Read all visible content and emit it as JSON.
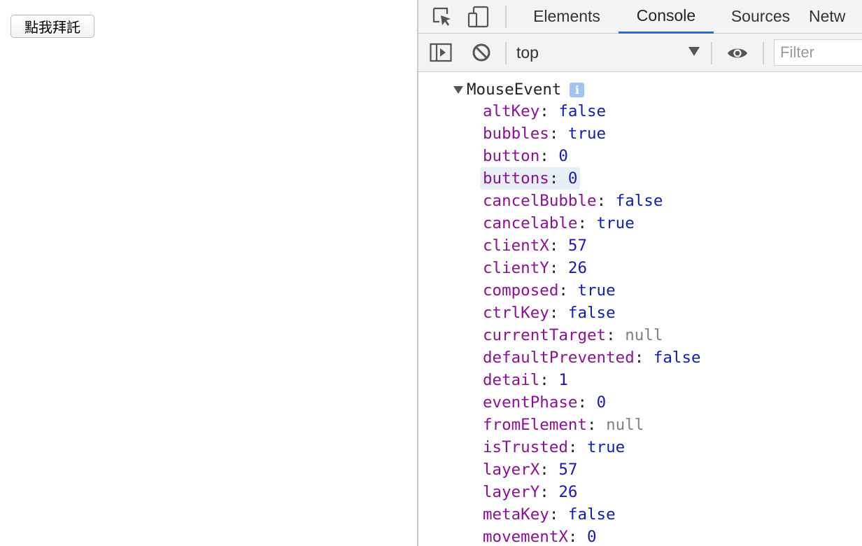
{
  "page": {
    "button_label": "點我拜託"
  },
  "devtools": {
    "tabs": [
      {
        "label": "Elements",
        "active": false
      },
      {
        "label": "Console",
        "active": true
      },
      {
        "label": "Sources",
        "active": false
      },
      {
        "label": "Netw",
        "active": false
      }
    ],
    "toolbar": {
      "context": "top",
      "filter_placeholder": "Filter"
    },
    "colors": {
      "accent": "#1a73e8",
      "key": "#881391",
      "bool": "#0d22aa",
      "null": "#808080"
    }
  },
  "console": {
    "object_name": "MouseEvent",
    "info_glyph": "i",
    "colon": ":",
    "properties": [
      {
        "key": "altKey",
        "value": "false",
        "type": "bool"
      },
      {
        "key": "bubbles",
        "value": "true",
        "type": "bool"
      },
      {
        "key": "button",
        "value": "0",
        "type": "num"
      },
      {
        "key": "buttons",
        "value": "0",
        "type": "num",
        "hover": true
      },
      {
        "key": "cancelBubble",
        "value": "false",
        "type": "bool"
      },
      {
        "key": "cancelable",
        "value": "true",
        "type": "bool"
      },
      {
        "key": "clientX",
        "value": "57",
        "type": "num"
      },
      {
        "key": "clientY",
        "value": "26",
        "type": "num"
      },
      {
        "key": "composed",
        "value": "true",
        "type": "bool"
      },
      {
        "key": "ctrlKey",
        "value": "false",
        "type": "bool"
      },
      {
        "key": "currentTarget",
        "value": "null",
        "type": "null"
      },
      {
        "key": "defaultPrevented",
        "value": "false",
        "type": "bool"
      },
      {
        "key": "detail",
        "value": "1",
        "type": "num"
      },
      {
        "key": "eventPhase",
        "value": "0",
        "type": "num"
      },
      {
        "key": "fromElement",
        "value": "null",
        "type": "null"
      },
      {
        "key": "isTrusted",
        "value": "true",
        "type": "bool"
      },
      {
        "key": "layerX",
        "value": "57",
        "type": "num"
      },
      {
        "key": "layerY",
        "value": "26",
        "type": "num"
      },
      {
        "key": "metaKey",
        "value": "false",
        "type": "bool"
      },
      {
        "key": "movementX",
        "value": "0",
        "type": "num"
      }
    ]
  }
}
